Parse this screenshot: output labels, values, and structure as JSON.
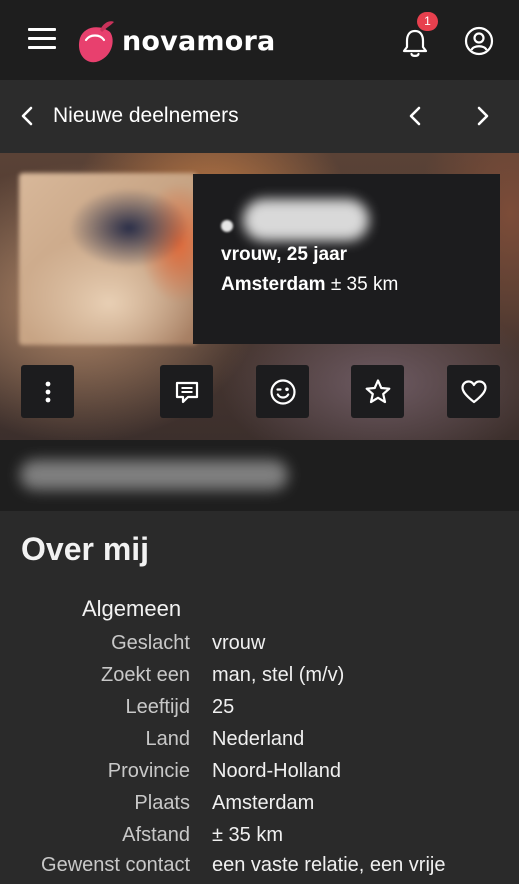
{
  "header": {
    "brand": "novamora",
    "notification_count": "1",
    "icons": [
      "hamburger-menu-icon",
      "novamora-logo",
      "bell-icon",
      "account-icon"
    ]
  },
  "subnav": {
    "title": "Nieuwe deelnemers",
    "icons": [
      "chevron-left-icon",
      "chevron-left-icon",
      "chevron-right-icon"
    ]
  },
  "profile": {
    "gender_age": "vrouw, 25 jaar",
    "city": "Amsterdam",
    "distance": "± 35 km",
    "actions": [
      {
        "name": "more-options",
        "icon": "kebab-menu-icon"
      },
      {
        "name": "message",
        "icon": "chat-bubble-icon"
      },
      {
        "name": "wink",
        "icon": "wink-face-icon"
      },
      {
        "name": "favorite",
        "icon": "star-icon"
      },
      {
        "name": "like",
        "icon": "heart-icon"
      }
    ]
  },
  "about": {
    "heading": "Over mij",
    "section": "Algemeen",
    "fields": [
      {
        "label": "Geslacht",
        "value": "vrouw"
      },
      {
        "label": "Zoekt een",
        "value": "man, stel (m/v)"
      },
      {
        "label": "Leeftijd",
        "value": "25"
      },
      {
        "label": "Land",
        "value": "Nederland"
      },
      {
        "label": "Provincie",
        "value": "Noord-Holland"
      },
      {
        "label": "Plaats",
        "value": "Amsterdam"
      },
      {
        "label": "Afstand",
        "value": "± 35 km"
      },
      {
        "label": "Gewenst contact",
        "value": "een vaste relatie, een vrije"
      }
    ]
  },
  "colors": {
    "accent": "#e8406e",
    "badge": "#e8404e",
    "header_bg": "#1e1e1e",
    "page_bg": "#2a2a2a"
  }
}
